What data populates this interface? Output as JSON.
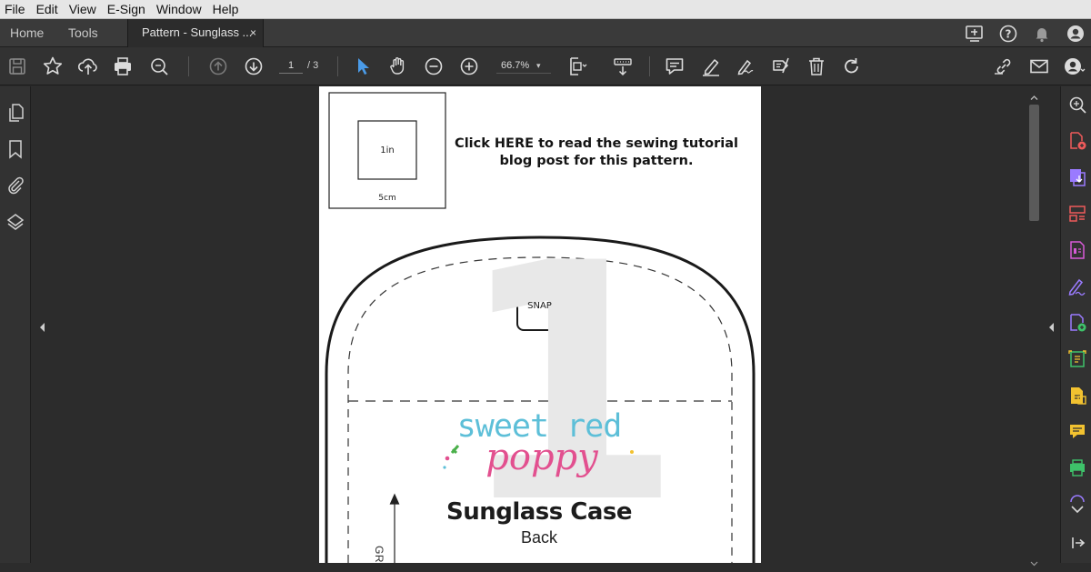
{
  "menu": [
    "File",
    "Edit",
    "View",
    "E-Sign",
    "Window",
    "Help"
  ],
  "tabs": {
    "home": "Home",
    "tools": "Tools",
    "document": "Pattern - Sunglass ...",
    "close": "×"
  },
  "toolbar": {
    "page_current": "1",
    "page_total": "/ 3",
    "zoom": "66.7%",
    "zoom_caret": "▾"
  },
  "page": {
    "scale_inner_label": "1in",
    "scale_outer_label": "5cm",
    "tutorial_line1": "Click HERE to read the sewing tutorial",
    "tutorial_line2": "blog post for this pattern.",
    "piece_number": "1",
    "snap_label": "SNAP",
    "brand_top": "sweet red",
    "brand_bottom": "poppy",
    "title": "Sunglass Case",
    "subtitle": "Back",
    "grain_label": "GRAINL"
  },
  "colors": {
    "brand_blue": "#5dbfd8",
    "brand_pink": "#e2508f",
    "icon_red": "#ee5a5a",
    "icon_purple": "#9a7bff",
    "icon_pink": "#d85ad8",
    "icon_green": "#3ec26a",
    "icon_yellow": "#f2c230",
    "select_blue": "#4a9be8"
  },
  "icons": {
    "toolbar": [
      "save-icon",
      "star-icon",
      "upload-cloud-icon",
      "print-icon",
      "zoom-search-icon",
      "previous-page-icon",
      "next-page-icon",
      "select-arrow-icon",
      "hand-icon",
      "zoom-out-icon",
      "zoom-in-icon",
      "fit-page-icon",
      "scrolling-mode-icon",
      "comment-icon",
      "highlight-icon",
      "sign-icon",
      "stamp-icon",
      "delete-icon",
      "rotate-icon",
      "share-link-icon",
      "mail-icon",
      "account-icon"
    ],
    "right_rail": [
      "zoom-search-icon",
      "export-pdf-icon",
      "create-pdf-icon",
      "organize-pages-icon",
      "edit-pdf-icon",
      "fill-sign-icon",
      "request-signature-icon",
      "scan-ocr-icon",
      "protect-icon",
      "comment-icon",
      "print-production-icon",
      "chevron-down-icon",
      "collapse-panel-icon"
    ]
  }
}
